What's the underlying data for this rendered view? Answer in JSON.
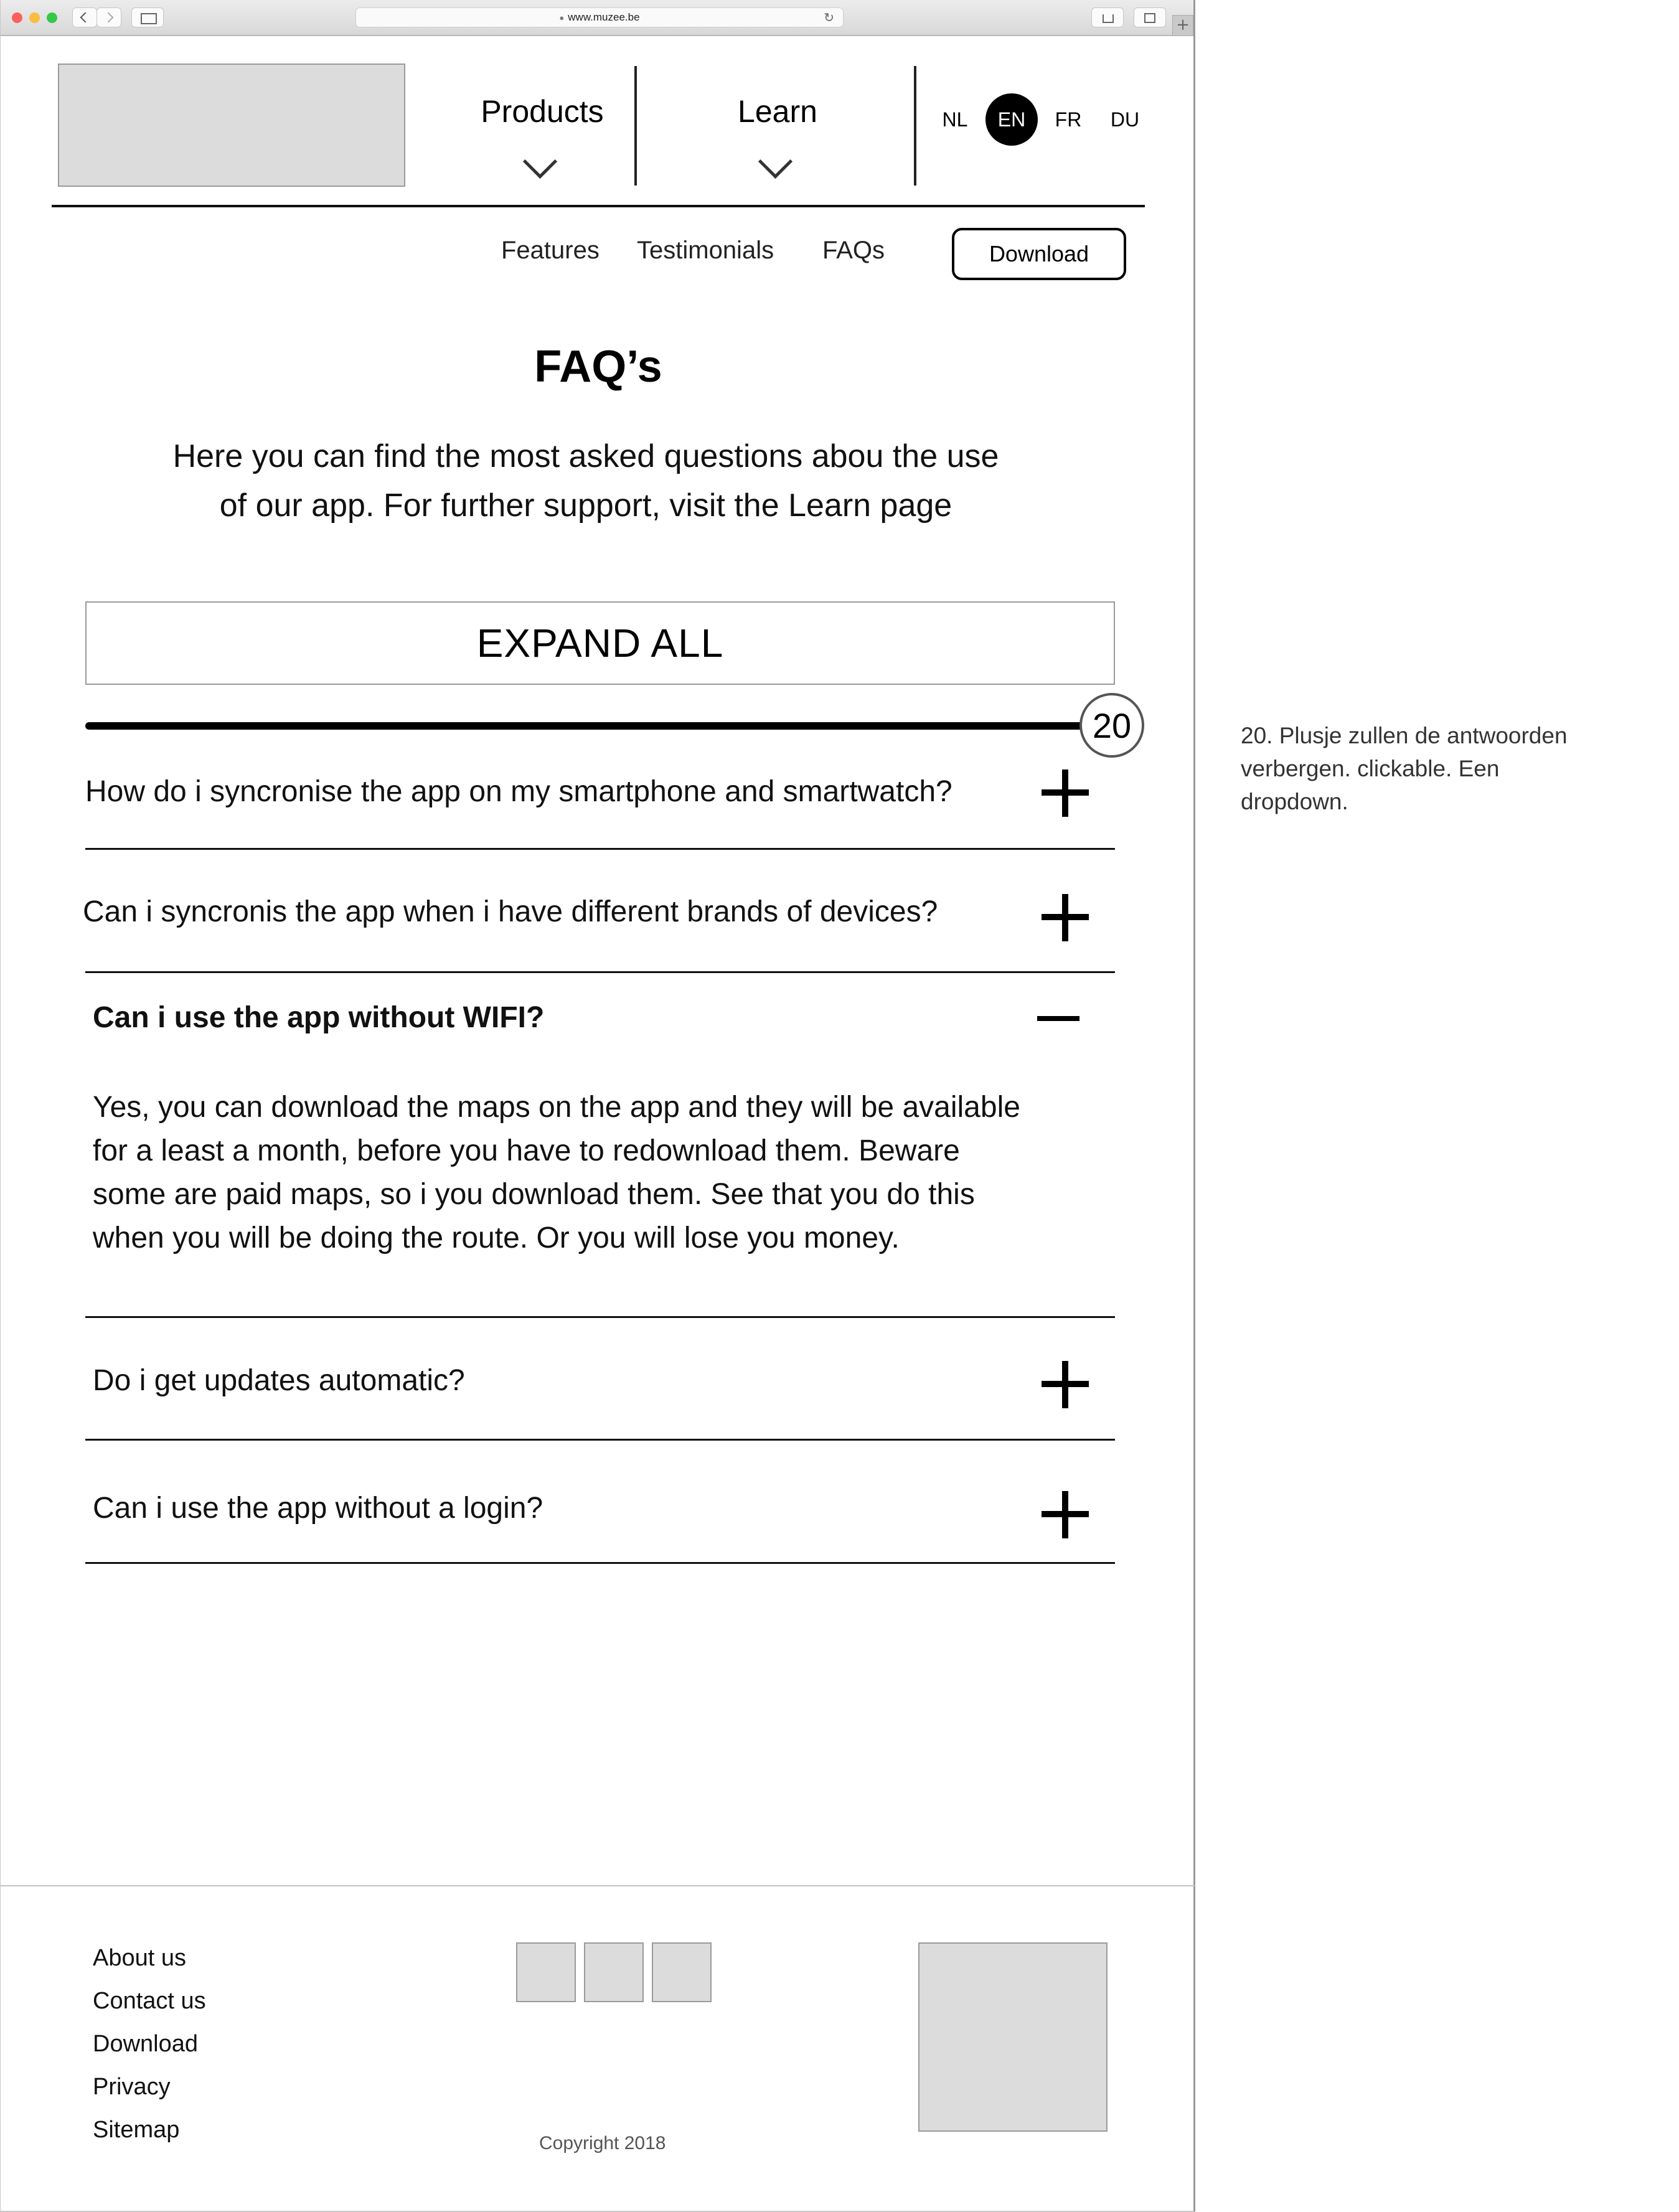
{
  "browser": {
    "url": "www.muzee.be"
  },
  "header": {
    "menus": [
      {
        "label": "Products"
      },
      {
        "label": "Learn"
      }
    ],
    "languages": [
      {
        "code": "NL",
        "active": false
      },
      {
        "code": "EN",
        "active": true
      },
      {
        "code": "FR",
        "active": false
      },
      {
        "code": "DU",
        "active": false
      }
    ]
  },
  "subnav": {
    "links": [
      {
        "label": "Features"
      },
      {
        "label": "Testimonials"
      },
      {
        "label": "FAQs"
      }
    ],
    "download_label": "Download"
  },
  "main": {
    "title": "FAQ’s",
    "intro_line1": "Here you can find the most asked questions abou the use",
    "intro_line2": "of our app. For further support, visit the Learn page",
    "expand_all_label": "EXPAND ALL",
    "annotation_number": "20",
    "faqs": [
      {
        "question": "How do i syncronise the app on my smartphone and smartwatch?",
        "expanded": false
      },
      {
        "question": "Can i syncronis the app when i have different brands of devices?",
        "expanded": false
      },
      {
        "question": "Can i use the app without WIFI?",
        "expanded": true,
        "answer_lines": [
          "Yes, you can download the maps on the app and they will be available",
          "for a least a month, before you have to redownload them. Beware",
          "some are paid maps, so i you download them. See that you do this",
          "when you will be doing the route. Or you will lose you money."
        ]
      },
      {
        "question": "Do i get updates automatic?",
        "expanded": false
      },
      {
        "question": "Can i use the app without a login?",
        "expanded": false
      }
    ]
  },
  "footer": {
    "links": [
      {
        "label": "About us"
      },
      {
        "label": "Contact us"
      },
      {
        "label": "Download"
      },
      {
        "label": "Privacy"
      },
      {
        "label": "Sitemap"
      }
    ],
    "copyright": "Copyright 2018"
  },
  "annotation_note": {
    "lines": [
      "20. Plusje zullen de antwoorden",
      "verbergen. clickable. Een",
      "dropdown."
    ]
  }
}
